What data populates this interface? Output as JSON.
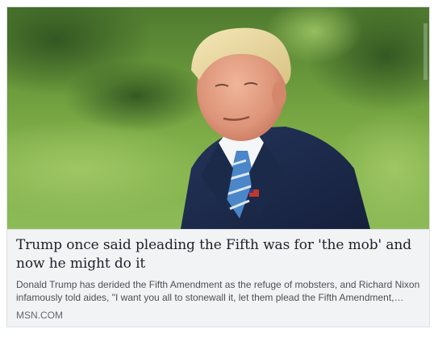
{
  "link_preview": {
    "image_alt": "Photo of Donald Trump outdoors",
    "headline": "Trump once said pleading the Fifth was for 'the mob' and now he might do it",
    "description": "Donald Trump has derided the Fifth Amendment as the refuge of mobsters, and Richard Nixon infamously told aides, \"I want you all to stonewall it, let them plead the Fifth Amendment,…",
    "domain": "MSN.COM"
  }
}
